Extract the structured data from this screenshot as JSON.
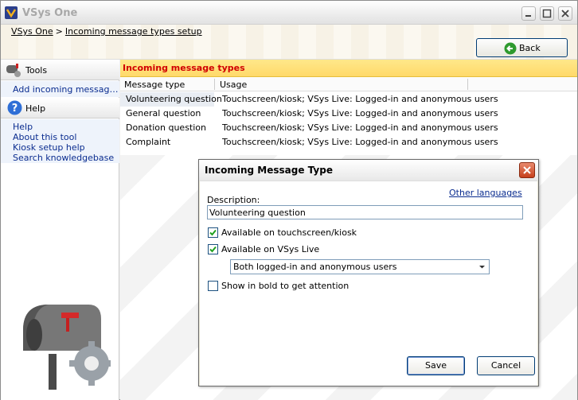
{
  "window": {
    "title": "VSys One"
  },
  "breadcrumb": {
    "home": "VSys One",
    "separator": ">",
    "current": "Incoming message types setup"
  },
  "toolbar": {
    "back_label": "Back"
  },
  "sidebar": {
    "tools_label": "Tools",
    "tools_links": [
      "Add incoming message t..."
    ],
    "help_label": "Help",
    "help_links": [
      "Help",
      "About this tool",
      "Kiosk setup help",
      "Search knowledgebase"
    ]
  },
  "main": {
    "section_title": "Incoming message types",
    "columns": [
      "Message type",
      "Usage"
    ],
    "rows": [
      {
        "type": "Volunteering question",
        "usage": "Touchscreen/kiosk; VSys Live: Logged-in and anonymous users"
      },
      {
        "type": "General question",
        "usage": "Touchscreen/kiosk; VSys Live: Logged-in and anonymous users"
      },
      {
        "type": "Donation question",
        "usage": "Touchscreen/kiosk; VSys Live: Logged-in and anonymous users"
      },
      {
        "type": "Complaint",
        "usage": "Touchscreen/kiosk; VSys Live: Logged-in and anonymous users"
      }
    ]
  },
  "dialog": {
    "title": "Incoming Message Type",
    "other_languages": "Other languages",
    "description_label": "Description:",
    "description_value": "Volunteering question",
    "touchscreen_label": "Available on touchscreen/kiosk",
    "touchscreen_checked": true,
    "vsyslive_label": "Available on VSys Live",
    "vsyslive_checked": true,
    "audience_selected": "Both logged-in and anonymous users",
    "bold_label": "Show in bold to get attention",
    "bold_checked": false,
    "save_label": "Save",
    "cancel_label": "Cancel"
  },
  "colors": {
    "section_title_text": "#d10000",
    "section_title_bg": "#ffd96a",
    "link": "#0a2c8f"
  }
}
